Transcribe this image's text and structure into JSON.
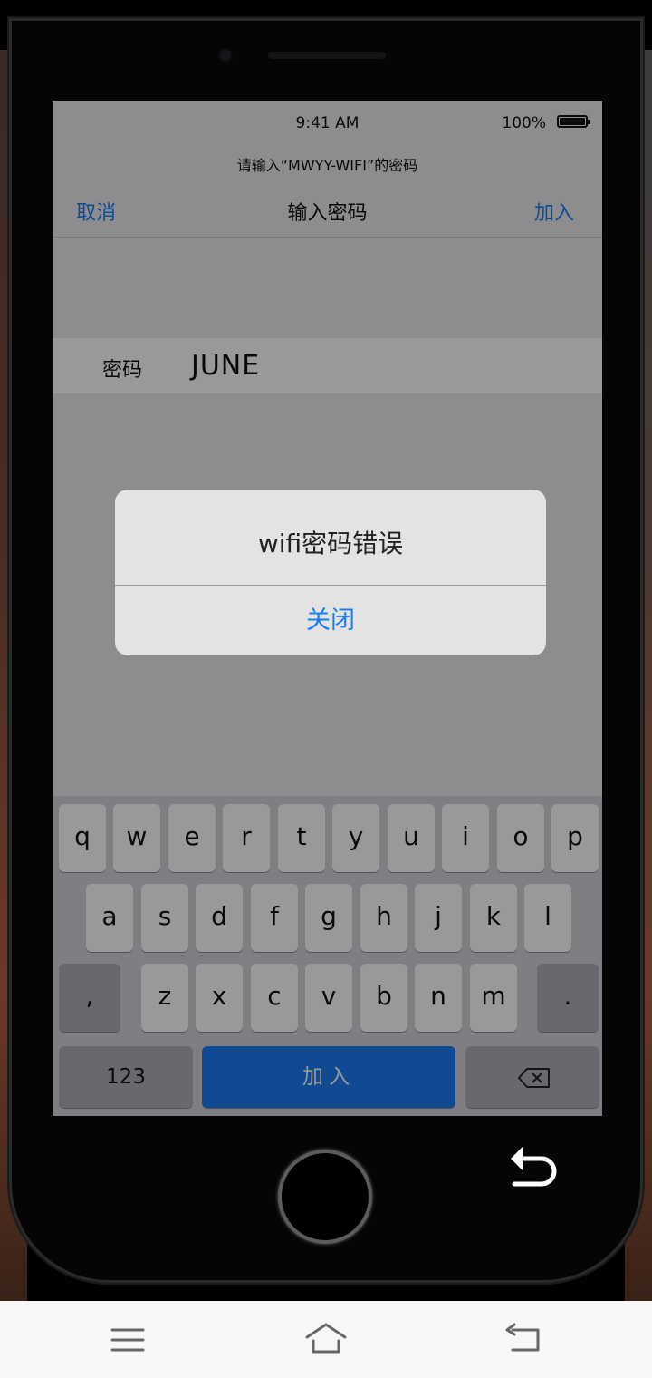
{
  "status": {
    "time": "9:41 AM",
    "battery": "100%"
  },
  "prompt": "请输入“MWYY-WIFI”的密码",
  "nav": {
    "cancel": "取消",
    "title": "输入密码",
    "join": "加入"
  },
  "field": {
    "label": "密码",
    "value": "JUNE"
  },
  "alert": {
    "title": "wifi密码错误",
    "button": "关闭"
  },
  "keyboard": {
    "row1": [
      "q",
      "w",
      "e",
      "r",
      "t",
      "y",
      "u",
      "i",
      "o",
      "p"
    ],
    "row2": [
      "a",
      "s",
      "d",
      "f",
      "g",
      "h",
      "j",
      "k",
      "l"
    ],
    "row3": [
      ",",
      "z",
      "x",
      "c",
      "v",
      "b",
      "n",
      "m",
      "."
    ],
    "numbers": "123",
    "return": "加入"
  },
  "icons": {
    "battery": "battery-icon",
    "backspace": "backspace-icon",
    "overlay_back": "return-arrow-icon",
    "android_nav": [
      "menu-icon",
      "home-icon",
      "back-icon"
    ]
  },
  "colors": {
    "accent": "#1a7cf5",
    "alert_bg": "#e3e3e3",
    "keyboard_bg": "#d1d4da"
  }
}
